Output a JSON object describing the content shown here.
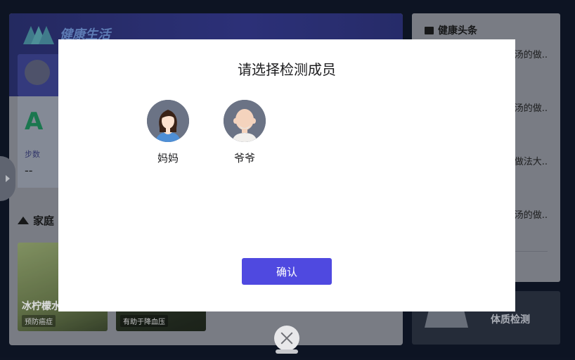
{
  "background": {
    "brand": "健康生活",
    "stat": {
      "big": "A",
      "label": "步数",
      "value": "--"
    },
    "family_title": "家庭",
    "cards": [
      {
        "title": "冰柠檬水",
        "tag": "预防癌症"
      },
      {
        "title": "",
        "tag": "有助于降血压"
      }
    ],
    "news": {
      "header": "健康头条",
      "items": [
        "汤的做..",
        "汤的做..",
        "做法大..",
        "汤的做.."
      ]
    },
    "check_label": "体质检测"
  },
  "modal": {
    "title": "请选择检测成员",
    "members": [
      {
        "name": "妈妈",
        "avatar_icon": "woman-avatar-icon"
      },
      {
        "name": "爷爷",
        "avatar_icon": "grandpa-avatar-icon"
      }
    ],
    "confirm_label": "确认"
  },
  "colors": {
    "accent": "#4f49e0",
    "header_bg": "#33378a",
    "app_bg": "#0f1626"
  }
}
